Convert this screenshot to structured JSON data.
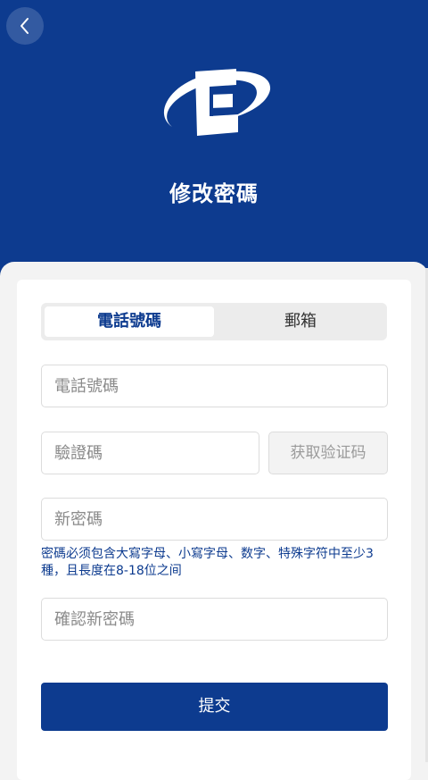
{
  "header": {
    "title": "修改密碼",
    "back_icon": "chevron-left-icon",
    "logo": "brand-logo"
  },
  "tabs": [
    {
      "label": "電話號碼",
      "active": true
    },
    {
      "label": "郵箱",
      "active": false
    }
  ],
  "form": {
    "phone": {
      "placeholder": "電話號碼",
      "value": ""
    },
    "code": {
      "placeholder": "驗證碼",
      "value": ""
    },
    "get_code_label": "获取验证码",
    "new_password": {
      "placeholder": "新密碼",
      "value": ""
    },
    "password_hint": "密碼必须包含大寫字母、小寫字母、数字、特殊字符中至少3種，且長度在8-18位之间",
    "confirm_password": {
      "placeholder": "確認新密碼",
      "value": ""
    },
    "submit_label": "提交"
  },
  "colors": {
    "brand": "#0d3b8f",
    "background": "#f3f3f3",
    "card": "#ffffff"
  }
}
